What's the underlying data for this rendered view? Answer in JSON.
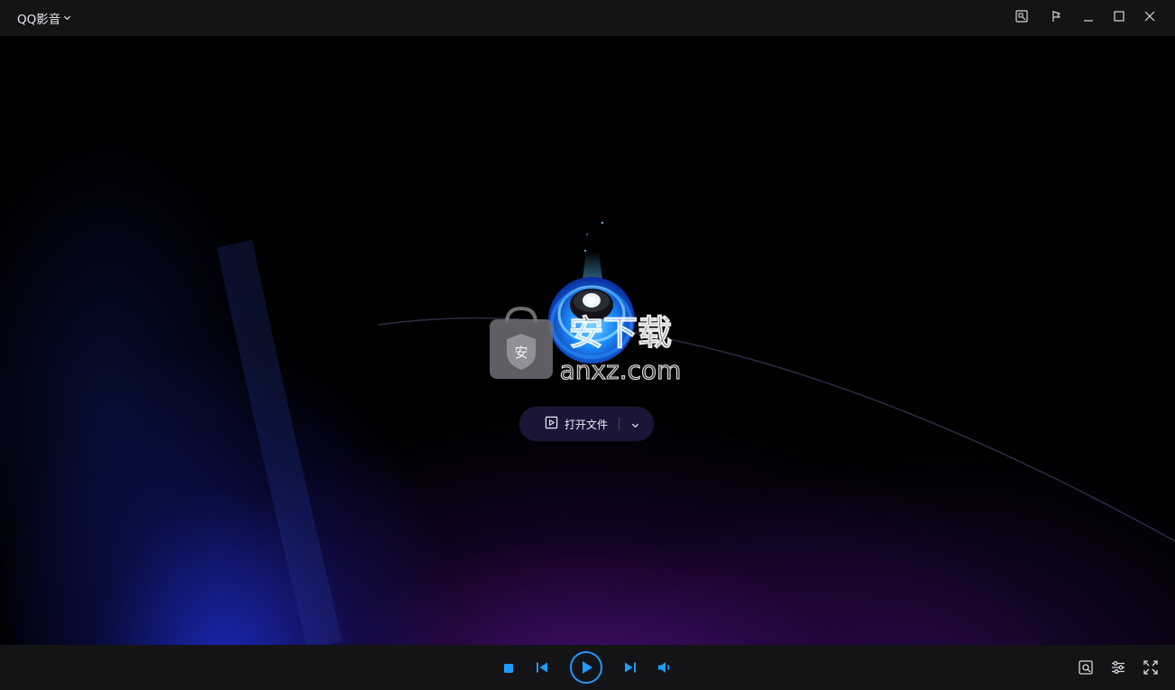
{
  "titlebar": {
    "app_title": "QQ影音",
    "icons": [
      "chevron-down-icon",
      "screenshot-icon",
      "pin-icon",
      "minimize-icon",
      "maximize-icon",
      "close-icon"
    ]
  },
  "stage": {
    "open_file_label": "打开文件",
    "watermark_text": "安下载",
    "watermark_subtext": "anxz.com",
    "watermark_badge": "安"
  },
  "controls": {
    "icons": [
      "stop-icon",
      "previous-icon",
      "play-icon",
      "next-icon",
      "volume-icon",
      "screen-capture-icon",
      "settings-icon",
      "fullscreen-icon"
    ]
  },
  "colors": {
    "accent": "#1e9bff",
    "titlebar_bg": "#141417",
    "button_bg": "#1b1638"
  }
}
